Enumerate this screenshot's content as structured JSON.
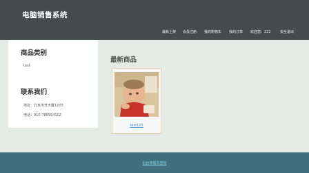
{
  "header": {
    "site_title": "电脑销售系统",
    "nav": [
      {
        "label": "最新上架"
      },
      {
        "label": "会员注册"
      },
      {
        "label": "我的购物车"
      },
      {
        "label": "我的订单"
      },
      {
        "label": "欢迎您：222"
      },
      {
        "label": "安全退出"
      }
    ]
  },
  "sidebar": {
    "categories_title": "商品类别",
    "categories": [
      {
        "label": "test"
      }
    ],
    "contact_title": "联系我们",
    "address": "地址：北京市开大厦1203",
    "phone": "电话：010-788564102"
  },
  "main": {
    "title": "最新商品",
    "products": [
      {
        "name": "test123"
      }
    ]
  },
  "footer": {
    "link_label": "后台管理员登陆"
  },
  "colors": {
    "header_bg": "#434b4d",
    "page_bg": "#e4ebe6",
    "footer_bg": "#3f6f7b",
    "link": "#3a89c9"
  }
}
